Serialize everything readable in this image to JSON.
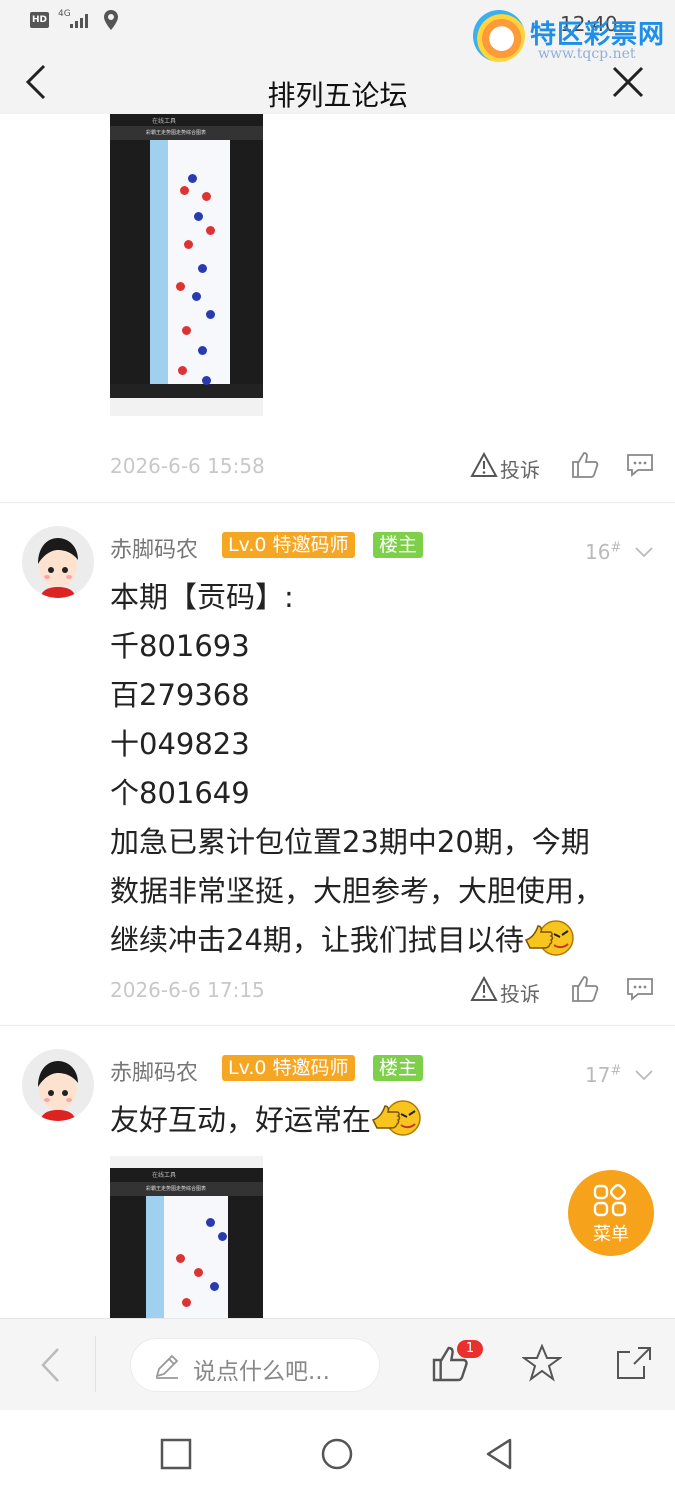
{
  "status_bar": {
    "hd": "HD",
    "network": "4G",
    "time": "12:40"
  },
  "watermark": {
    "brand": "特区彩票网",
    "url": "www.tqcp.net"
  },
  "header": {
    "title": "排列五论坛"
  },
  "posts": [
    {
      "timestamp": "2026-6-6 15:58",
      "report_label": "投诉"
    },
    {
      "username": "赤脚码农",
      "level_badge": "Lv.0 特邀码师",
      "host_badge": "楼主",
      "floor": "16",
      "floor_mark": "#",
      "lines": [
        "本期【贡码】:",
        "千801693",
        "百279368",
        "十049823",
        "个801649",
        "加急已累计包位置23期中20期，今期",
        "数据非常坚挺，大胆参考，大胆使用，",
        "继续冲击24期，让我们拭目以待"
      ],
      "timestamp": "2026-6-6 17:15",
      "report_label": "投诉"
    },
    {
      "username": "赤脚码农",
      "level_badge": "Lv.0 特邀码师",
      "host_badge": "楼主",
      "floor": "17",
      "floor_mark": "#",
      "lines": [
        "友好互动，好运常在"
      ]
    }
  ],
  "embedded_shot": {
    "title": "在线工具",
    "subtitle": "彩霸王走势图走势综合图表"
  },
  "float_menu": {
    "label": "菜单"
  },
  "bottom_bar": {
    "comment_placeholder": "说点什么吧...",
    "like_count": "1"
  }
}
